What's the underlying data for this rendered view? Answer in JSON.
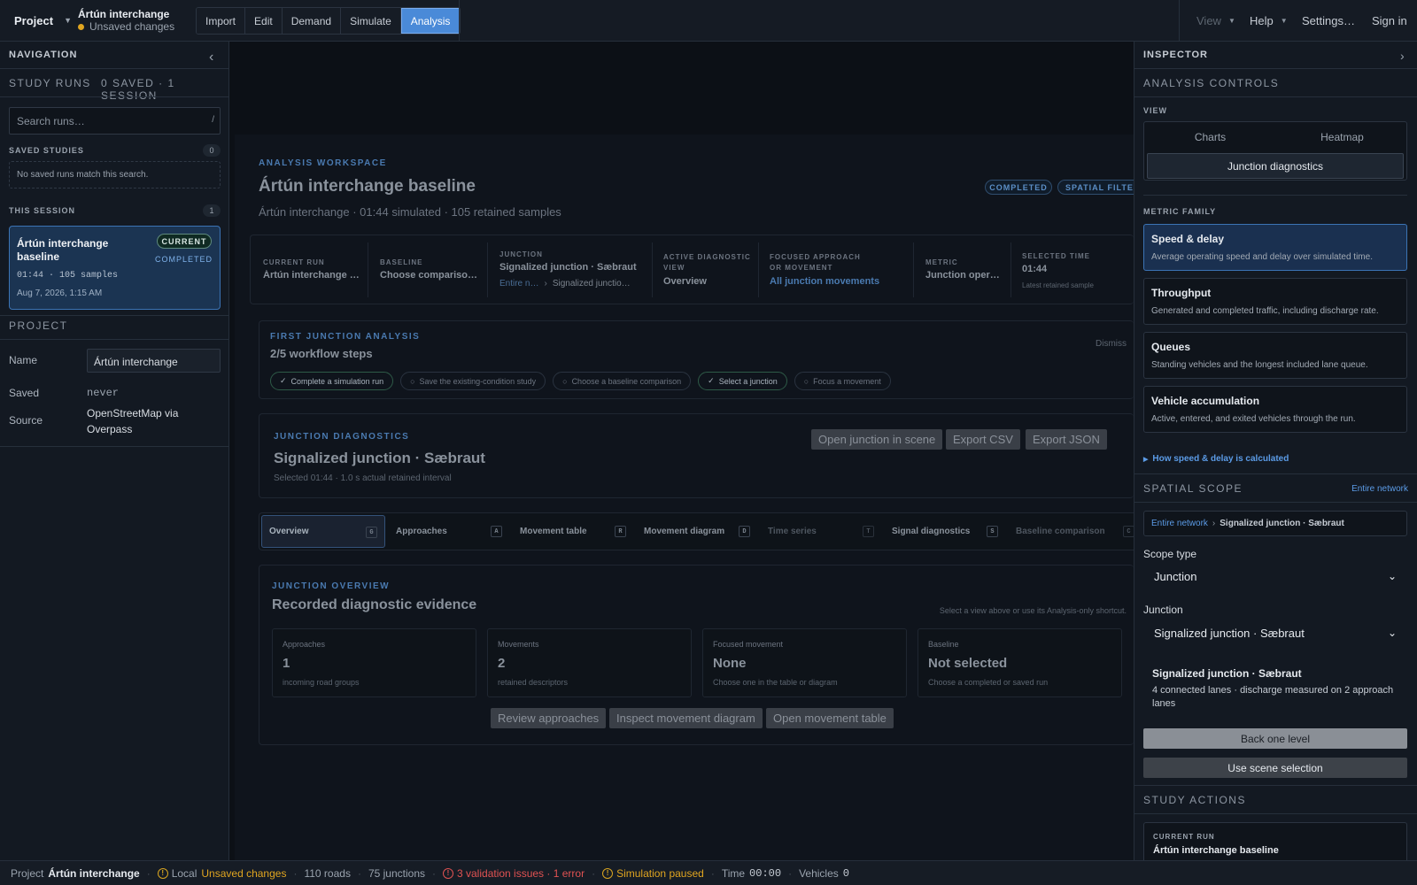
{
  "topbar": {
    "project_label": "Project",
    "project_name": "Ártún interchange",
    "unsaved": "Unsaved changes",
    "menu": [
      "Import",
      "Edit",
      "Demand",
      "Simulate",
      "Analysis"
    ],
    "active_menu": "Analysis",
    "view": "View",
    "help": "Help",
    "settings": "Settings…",
    "signin": "Sign in"
  },
  "nav": {
    "title": "NAVIGATION",
    "study_runs": "STUDY RUNS",
    "study_counts": "0 SAVED · 1 SESSION",
    "search_placeholder": "Search runs…",
    "search_shortcut": "/",
    "saved_studies": "SAVED STUDIES",
    "saved_count": "0",
    "no_saved": "No saved runs match this search.",
    "this_session": "THIS SESSION",
    "session_count": "1",
    "run": {
      "title": "Ártún interchange baseline",
      "current": "CURRENT",
      "status": "COMPLETED",
      "meta": "01:44 · 105 samples",
      "date": "Aug 7, 2026, 1:15 AM"
    },
    "project_title": "PROJECT",
    "name_label": "Name",
    "name_value": "Ártún interchange",
    "saved_label": "Saved",
    "saved_value": "never",
    "source_label": "Source",
    "source_value": "OpenStreetMap via Overpass"
  },
  "workspace": {
    "kicker": "ANALYSIS WORKSPACE",
    "title": "Ártún interchange baseline",
    "subtitle": "Ártún interchange · 01:44 simulated · 105 retained samples",
    "badges": [
      "COMPLETED",
      "SPATIAL FILTER"
    ],
    "summary": {
      "current_run_label": "CURRENT RUN",
      "current_run": "Ártún interchange …",
      "baseline_label": "BASELINE",
      "baseline": "Choose compariso…",
      "junction_label": "JUNCTION",
      "junction": "Signalized junction · Sæbraut",
      "junction_crumb1": "Entire n…",
      "junction_crumb2": "Signalized junctio…",
      "view_label": "ACTIVE DIAGNOSTIC VIEW",
      "view": "Overview",
      "focus_label": "FOCUSED APPROACH OR MOVEMENT",
      "focus": "All junction movements",
      "metric_label": "METRIC",
      "metric": "Junction oper…",
      "time_label": "SELECTED TIME",
      "time": "01:44",
      "time_note": "Latest retained sample"
    },
    "first": {
      "kicker": "FIRST JUNCTION ANALYSIS",
      "progress": "2/5 workflow steps",
      "dismiss": "Dismiss",
      "steps": [
        {
          "label": "Complete a simulation run",
          "done": true
        },
        {
          "label": "Save the existing-condition study",
          "done": false
        },
        {
          "label": "Choose a baseline comparison",
          "done": false
        },
        {
          "label": "Select a junction",
          "done": true
        },
        {
          "label": "Focus a movement",
          "done": false
        }
      ]
    },
    "diag": {
      "kicker": "JUNCTION DIAGNOSTICS",
      "title": "Signalized junction · Sæbraut",
      "note": "Selected 01:44 · 1.0 s actual retained interval",
      "open_scene": "Open junction in scene",
      "export_csv": "Export CSV",
      "export_json": "Export JSON"
    },
    "tabs": [
      {
        "label": "Overview",
        "key": "G"
      },
      {
        "label": "Approaches",
        "key": "A"
      },
      {
        "label": "Movement table",
        "key": "R"
      },
      {
        "label": "Movement diagram",
        "key": "D"
      },
      {
        "label": "Time series",
        "key": "T"
      },
      {
        "label": "Signal diagnostics",
        "key": "S"
      },
      {
        "label": "Baseline comparison",
        "key": "C"
      }
    ],
    "overview": {
      "kicker": "JUNCTION OVERVIEW",
      "title": "Recorded diagnostic evidence",
      "hint": "Select a view above or use its Analysis-only shortcut.",
      "stats": [
        {
          "label": "Approaches",
          "value": "1",
          "note": "incoming road groups"
        },
        {
          "label": "Movements",
          "value": "2",
          "note": "retained descriptors"
        },
        {
          "label": "Focused movement",
          "value": "None",
          "note": "Choose one in the table or diagram"
        },
        {
          "label": "Baseline",
          "value": "Not selected",
          "note": "Choose a completed or saved run"
        }
      ],
      "btn_review": "Review approaches",
      "btn_inspect": "Inspect movement diagram",
      "btn_open": "Open movement table"
    }
  },
  "inspector": {
    "title": "INSPECTOR",
    "controls": "ANALYSIS CONTROLS",
    "view_label": "VIEW",
    "view_charts": "Charts",
    "view_heatmap": "Heatmap",
    "view_junction": "Junction diagnostics",
    "metric_family": "METRIC FAMILY",
    "metrics": [
      {
        "title": "Speed & delay",
        "desc": "Average operating speed and delay over simulated time."
      },
      {
        "title": "Throughput",
        "desc": "Generated and completed traffic, including discharge rate."
      },
      {
        "title": "Queues",
        "desc": "Standing vehicles and the longest included lane queue."
      },
      {
        "title": "Vehicle accumulation",
        "desc": "Active, entered, and exited vehicles through the run."
      }
    ],
    "how_link": "How speed & delay is calculated",
    "spatial_scope": "SPATIAL SCOPE",
    "scope_entire": "Entire network",
    "crumb_root": "Entire network",
    "crumb_leaf": "Signalized junction · Sæbraut",
    "scope_type_label": "Scope type",
    "scope_type": "Junction",
    "junction_label": "Junction",
    "junction": "Signalized junction · Sæbraut",
    "junction_info_title": "Signalized junction · Sæbraut",
    "junction_info": "4 connected lanes · discharge measured on 2 approach lanes",
    "back_level": "Back one level",
    "use_selection": "Use scene selection",
    "study_actions": "STUDY ACTIONS",
    "current_run_label": "CURRENT RUN",
    "current_run": "Ártún interchange baseline"
  },
  "status": {
    "project_label": "Project",
    "project": "Ártún interchange",
    "local": "Local",
    "unsaved": "Unsaved changes",
    "roads": "110 roads",
    "junctions": "75 junctions",
    "issues": "3 validation issues · 1 error",
    "sim": "Simulation paused",
    "time_label": "Time",
    "time": "00:00",
    "vehicles_label": "Vehicles",
    "vehicles": "0"
  },
  "colors": {
    "accent": "#4a8ad8",
    "warning": "#e0a520",
    "error": "#e05252",
    "link": "#5b9be6"
  }
}
